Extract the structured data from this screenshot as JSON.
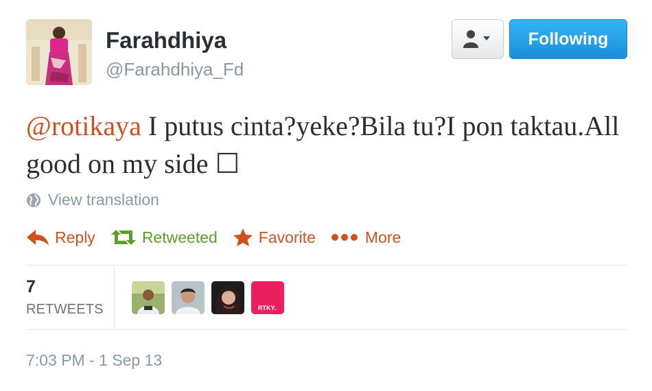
{
  "user": {
    "name": "Farahdhiya",
    "handle": "@Farahdhiya_Fd"
  },
  "buttons": {
    "follow_label": "Following",
    "user_menu_icon": "person-icon with chevron-down-icon"
  },
  "tweet": {
    "mention": "@rotikaya",
    "text": " I putus cinta?yeke?Bila tu?I pon taktau.All good on my side ☐"
  },
  "translate": {
    "label": "View translation",
    "icon": "globe-icon"
  },
  "actions": {
    "reply": "Reply",
    "retweeted": "Retweeted",
    "favorite": "Favorite",
    "more": "More"
  },
  "stats": {
    "retweet_count": "7",
    "retweet_label": "RETWEETS"
  },
  "retweeters": {
    "badge_text": "RTKY."
  },
  "timestamp": "7:03 PM - 1 Sep 13",
  "colors": {
    "link": "#d0501f",
    "retweet": "#5c9f2b",
    "follow_button": "#2aa6ee",
    "muted": "#8899a6"
  }
}
